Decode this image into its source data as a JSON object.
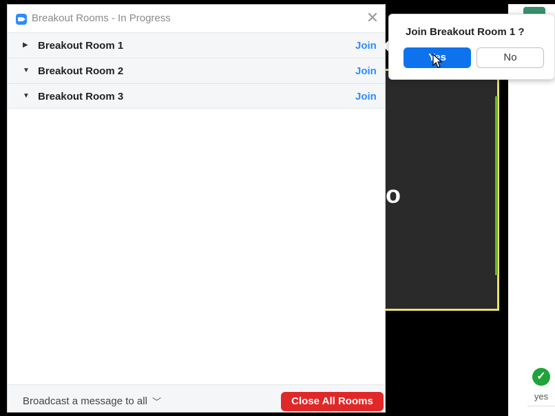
{
  "window": {
    "title": "Breakout Rooms - In Progress",
    "close_icon": "close-icon",
    "app_icon": "zoom-video-icon"
  },
  "rooms": [
    {
      "name": "Breakout Room 1",
      "action": "Join",
      "expanded": false
    },
    {
      "name": "Breakout Room 2",
      "action": "Join",
      "expanded": true
    },
    {
      "name": "Breakout Room 3",
      "action": "Join",
      "expanded": true
    }
  ],
  "footer": {
    "broadcast_label": "Broadcast a message to all",
    "close_all_label": "Close All Rooms"
  },
  "confirm": {
    "question": "Join Breakout Room 1 ?",
    "yes_label": "Yes",
    "no_label": "No"
  },
  "background": {
    "tile_text": "o",
    "reaction_label": "yes"
  },
  "colors": {
    "accent": "#2d8cff",
    "primary_button": "#0e72ed",
    "danger": "#e02828",
    "reaction_green": "#1fa33a"
  }
}
